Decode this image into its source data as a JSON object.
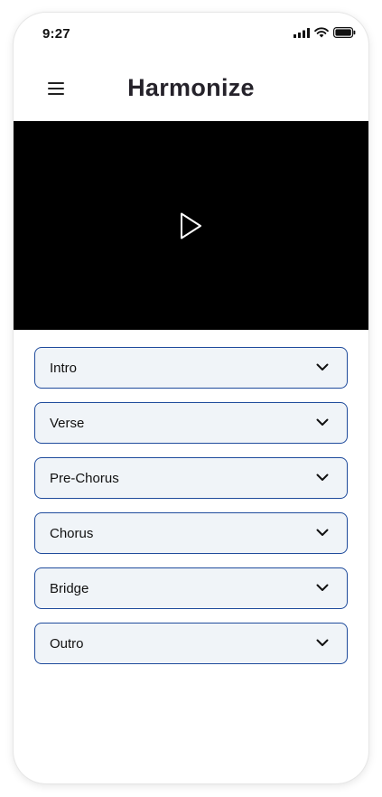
{
  "status_bar": {
    "time": "9:27",
    "icons": [
      "signal-icon",
      "wifi-icon",
      "battery-icon"
    ]
  },
  "header": {
    "menu_icon": "hamburger-menu-icon",
    "title": "Harmonize"
  },
  "video": {
    "play_icon": "play-icon",
    "background_color": "#000000"
  },
  "sections": [
    {
      "label": "Intro",
      "icon": "chevron-down-icon"
    },
    {
      "label": "Verse",
      "icon": "chevron-down-icon"
    },
    {
      "label": "Pre-Chorus",
      "icon": "chevron-down-icon"
    },
    {
      "label": "Chorus",
      "icon": "chevron-down-icon"
    },
    {
      "label": "Bridge",
      "icon": "chevron-down-icon"
    },
    {
      "label": "Outro",
      "icon": "chevron-down-icon"
    }
  ],
  "colors": {
    "accordion_border": "#1f4b9c",
    "accordion_background": "#f0f4f8",
    "title_color": "#25222a"
  }
}
